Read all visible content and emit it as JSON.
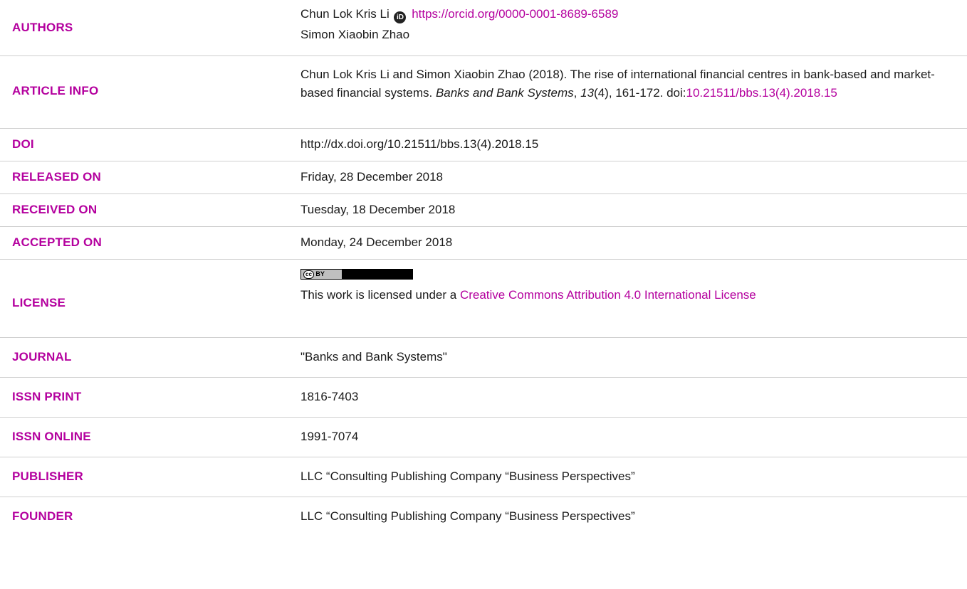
{
  "rows": {
    "authors": {
      "label": "AUTHORS",
      "author1": "Chun Lok Kris Li",
      "author1_orcid": "https://orcid.org/0000-0001-8689-6589",
      "author2": "Simon Xiaobin Zhao"
    },
    "article_info": {
      "label": "ARTICLE INFO",
      "citation_prefix": "Chun Lok Kris Li and Simon Xiaobin Zhao (2018). The rise of international financial centres in bank-based and market-based financial systems.",
      "journal_italic": "Banks and Bank Systems",
      "sep1": ",",
      "volume_italic": "13",
      "issue_pages": "(4), 161-172. doi:",
      "doi_link": "10.21511/bbs.13(4).2018.15"
    },
    "doi": {
      "label": "DOI",
      "value": "http://dx.doi.org/10.21511/bbs.13(4).2018.15"
    },
    "released_on": {
      "label": "RELEASED ON",
      "value": "Friday, 28 December 2018"
    },
    "received_on": {
      "label": "RECEIVED ON",
      "value": "Tuesday, 18 December 2018"
    },
    "accepted_on": {
      "label": "ACCEPTED ON",
      "value": "Monday, 24 December 2018"
    },
    "license": {
      "label": "LICENSE",
      "badge_cc": "cc",
      "badge_by": "BY",
      "text_prefix": "This work is licensed under a",
      "link": "Creative Commons Attribution 4.0 International License"
    },
    "journal": {
      "label": "JOURNAL",
      "value": "\"Banks and Bank Systems\""
    },
    "issn_print": {
      "label": "ISSN PRINT",
      "value": "1816-7403"
    },
    "issn_online": {
      "label": "ISSN ONLINE",
      "value": "1991-7074"
    },
    "publisher": {
      "label": "PUBLISHER",
      "value": "LLC “Consulting Publishing Company “Business Perspectives”"
    },
    "founder": {
      "label": "FOUNDER",
      "value": "LLC “Consulting Publishing Company “Business Perspectives”"
    }
  },
  "icons": {
    "orcid": "orcid-icon",
    "license_badge": "cc-by-badge"
  },
  "colors": {
    "label": "#b4009e",
    "link": "#b4009e",
    "text": "#1a1a1a",
    "divider": "#cfcfcf"
  }
}
